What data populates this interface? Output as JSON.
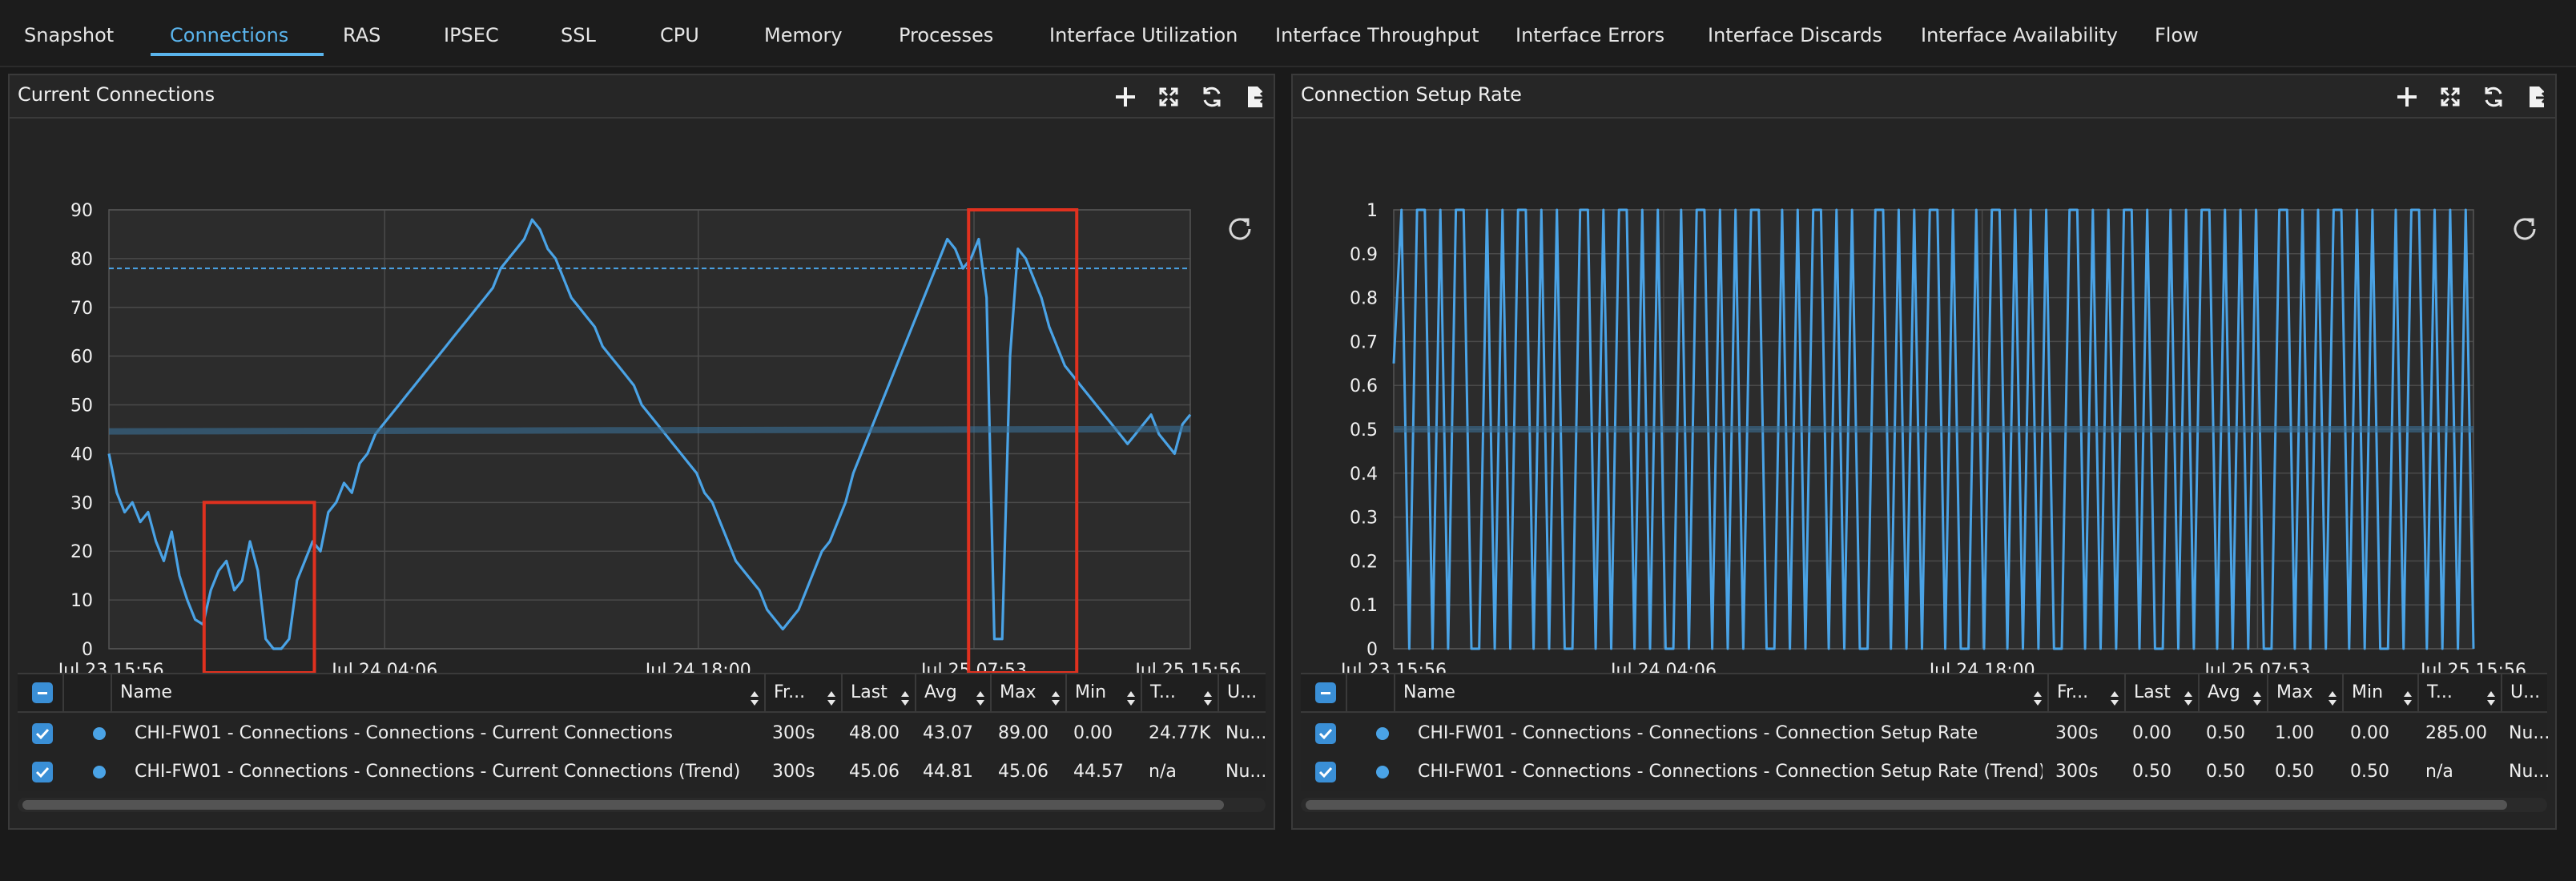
{
  "tabs": [
    {
      "label": "Snapshot",
      "active": false
    },
    {
      "label": "Connections",
      "active": true
    },
    {
      "label": "RAS",
      "active": false
    },
    {
      "label": "IPSEC",
      "active": false
    },
    {
      "label": "SSL",
      "active": false
    },
    {
      "label": "CPU",
      "active": false
    },
    {
      "label": "Memory",
      "active": false
    },
    {
      "label": "Processes",
      "active": false
    },
    {
      "label": "Interface Utilization",
      "active": false
    },
    {
      "label": "Interface Throughput",
      "active": false
    },
    {
      "label": "Interface Errors",
      "active": false
    },
    {
      "label": "Interface Discards",
      "active": false
    },
    {
      "label": "Interface Availability",
      "active": false
    },
    {
      "label": "Flow",
      "active": false
    }
  ],
  "colors": {
    "accent": "#5ab4ec",
    "series": "#4aa3e6",
    "highlight": "#e0311f"
  },
  "panels": [
    {
      "title": "Current Connections",
      "header_icons": [
        "plus-icon",
        "expand-icon",
        "refresh-icon",
        "export-icon"
      ],
      "table": {
        "columns": [
          "Name",
          "Fr...",
          "Last",
          "Avg",
          "Max",
          "Min",
          "T...",
          "U..."
        ],
        "rows": [
          {
            "name": "CHI-FW01 - Connections - Connections - Current Connections",
            "freq": "300s",
            "last": "48.00",
            "avg": "43.07",
            "max": "89.00",
            "min": "0.00",
            "total": "24.77K",
            "unit": "Nu..."
          },
          {
            "name": "CHI-FW01 - Connections - Connections - Current Connections (Trend)",
            "freq": "300s",
            "last": "45.06",
            "avg": "44.81",
            "max": "45.06",
            "min": "44.57",
            "total": "n/a",
            "unit": "Nu..."
          }
        ]
      }
    },
    {
      "title": "Connection Setup Rate",
      "header_icons": [
        "plus-icon",
        "expand-icon",
        "refresh-icon",
        "export-icon"
      ],
      "table": {
        "columns": [
          "Name",
          "Fr...",
          "Last",
          "Avg",
          "Max",
          "Min",
          "T...",
          "U..."
        ],
        "rows": [
          {
            "name": "CHI-FW01 - Connections - Connections - Connection Setup Rate",
            "freq": "300s",
            "last": "0.00",
            "avg": "0.50",
            "max": "1.00",
            "min": "0.00",
            "total": "285.00",
            "unit": "Nu..."
          },
          {
            "name": "CHI-FW01 - Connections - Connections - Connection Setup Rate (Trend)",
            "freq": "300s",
            "last": "0.50",
            "avg": "0.50",
            "max": "0.50",
            "min": "0.50",
            "total": "n/a",
            "unit": "Nu..."
          }
        ]
      }
    }
  ],
  "chart_data": [
    {
      "type": "line",
      "title": "Current Connections",
      "x_ticks": [
        "Jul 23 15:56",
        "Jul 24 04:06",
        "Jul 24 18:00",
        "Jul 25 07:53",
        "Jul 25 15:56"
      ],
      "y_ticks": [
        "0",
        "10",
        "20",
        "30",
        "40",
        "50",
        "60",
        "70",
        "80",
        "90"
      ],
      "ylim": [
        0,
        90
      ],
      "grid": true,
      "threshold": 78,
      "series": [
        {
          "values": [
            40,
            32,
            28,
            30,
            26,
            28,
            22,
            18,
            24,
            15,
            10,
            6,
            5,
            12,
            16,
            18,
            12,
            14,
            22,
            16,
            2,
            0,
            0,
            2,
            14,
            18,
            22,
            20,
            28,
            30,
            34,
            32,
            38,
            40,
            44,
            46,
            48,
            50,
            52,
            54,
            56,
            58,
            60,
            62,
            64,
            66,
            68,
            70,
            72,
            74,
            78,
            80,
            82,
            84,
            88,
            86,
            82,
            80,
            76,
            72,
            70,
            68,
            66,
            62,
            60,
            58,
            56,
            54,
            50,
            48,
            46,
            44,
            42,
            40,
            38,
            36,
            32,
            30,
            26,
            22,
            18,
            16,
            14,
            12,
            8,
            6,
            4,
            6,
            8,
            12,
            16,
            20,
            22,
            26,
            30,
            36,
            40,
            44,
            48,
            52,
            56,
            60,
            64,
            68,
            72,
            76,
            80,
            84,
            82,
            78,
            80,
            84,
            72,
            2,
            2,
            60,
            82,
            80,
            76,
            72,
            66,
            62,
            58,
            56,
            54,
            52,
            50,
            48,
            46,
            44,
            42,
            44,
            46,
            48,
            44,
            42,
            40,
            46,
            48
          ]
        },
        {
          "values": [
            44.57,
            44.6,
            44.65,
            44.7,
            44.75,
            44.8,
            44.85,
            44.9,
            44.95,
            45.0,
            45.06
          ]
        }
      ],
      "annotations": [
        {
          "x_start": 0.088,
          "x_end": 0.19,
          "y_start": 0,
          "y_end": 30
        },
        {
          "x_start": 0.795,
          "x_end": 0.895,
          "y_start": 0,
          "y_end": 90
        }
      ]
    },
    {
      "type": "line",
      "title": "Connection Setup Rate",
      "x_ticks": [
        "Jul 23 15:56",
        "Jul 24 04:06",
        "Jul 24 18:00",
        "Jul 25 07:53",
        "Jul 25 15:56"
      ],
      "y_ticks": [
        "0",
        "0.1",
        "0.2",
        "0.3",
        "0.4",
        "0.5",
        "0.6",
        "0.7",
        "0.8",
        "0.9",
        "1"
      ],
      "ylim": [
        0,
        1
      ],
      "grid": true,
      "series": [
        {
          "values": [
            0.65,
            1,
            0,
            1,
            1,
            0,
            1,
            0,
            1,
            1,
            0,
            0,
            1,
            0,
            1,
            0,
            1,
            1,
            0,
            1,
            0,
            1,
            0,
            0,
            1,
            1,
            0,
            1,
            0,
            1,
            1,
            0,
            1,
            0,
            1,
            0,
            0,
            1,
            0,
            1,
            1,
            0,
            1,
            0,
            1,
            0,
            1,
            1,
            0,
            0,
            1,
            0,
            1,
            0,
            1,
            1,
            0,
            1,
            0,
            1,
            0,
            0,
            1,
            1,
            0,
            1,
            0,
            1,
            0,
            1,
            1,
            0,
            1,
            0,
            0,
            1,
            0,
            1,
            1,
            0,
            1,
            0,
            1,
            0,
            1,
            0,
            0,
            1,
            1,
            0,
            1,
            0,
            1,
            0,
            1,
            1,
            0,
            1,
            0,
            0,
            1,
            0,
            1,
            0,
            1,
            1,
            0,
            1,
            0,
            1,
            0,
            1,
            0,
            0,
            1,
            1,
            0,
            1,
            0,
            1,
            0,
            1,
            1,
            0,
            1,
            0,
            1,
            0,
            0,
            1,
            0,
            1,
            1,
            0,
            1,
            0,
            1,
            0,
            1,
            0
          ]
        },
        {
          "values": [
            0.5,
            0.5,
            0.5,
            0.5,
            0.5,
            0.5,
            0.5,
            0.5,
            0.5,
            0.5,
            0.5
          ]
        }
      ]
    }
  ]
}
